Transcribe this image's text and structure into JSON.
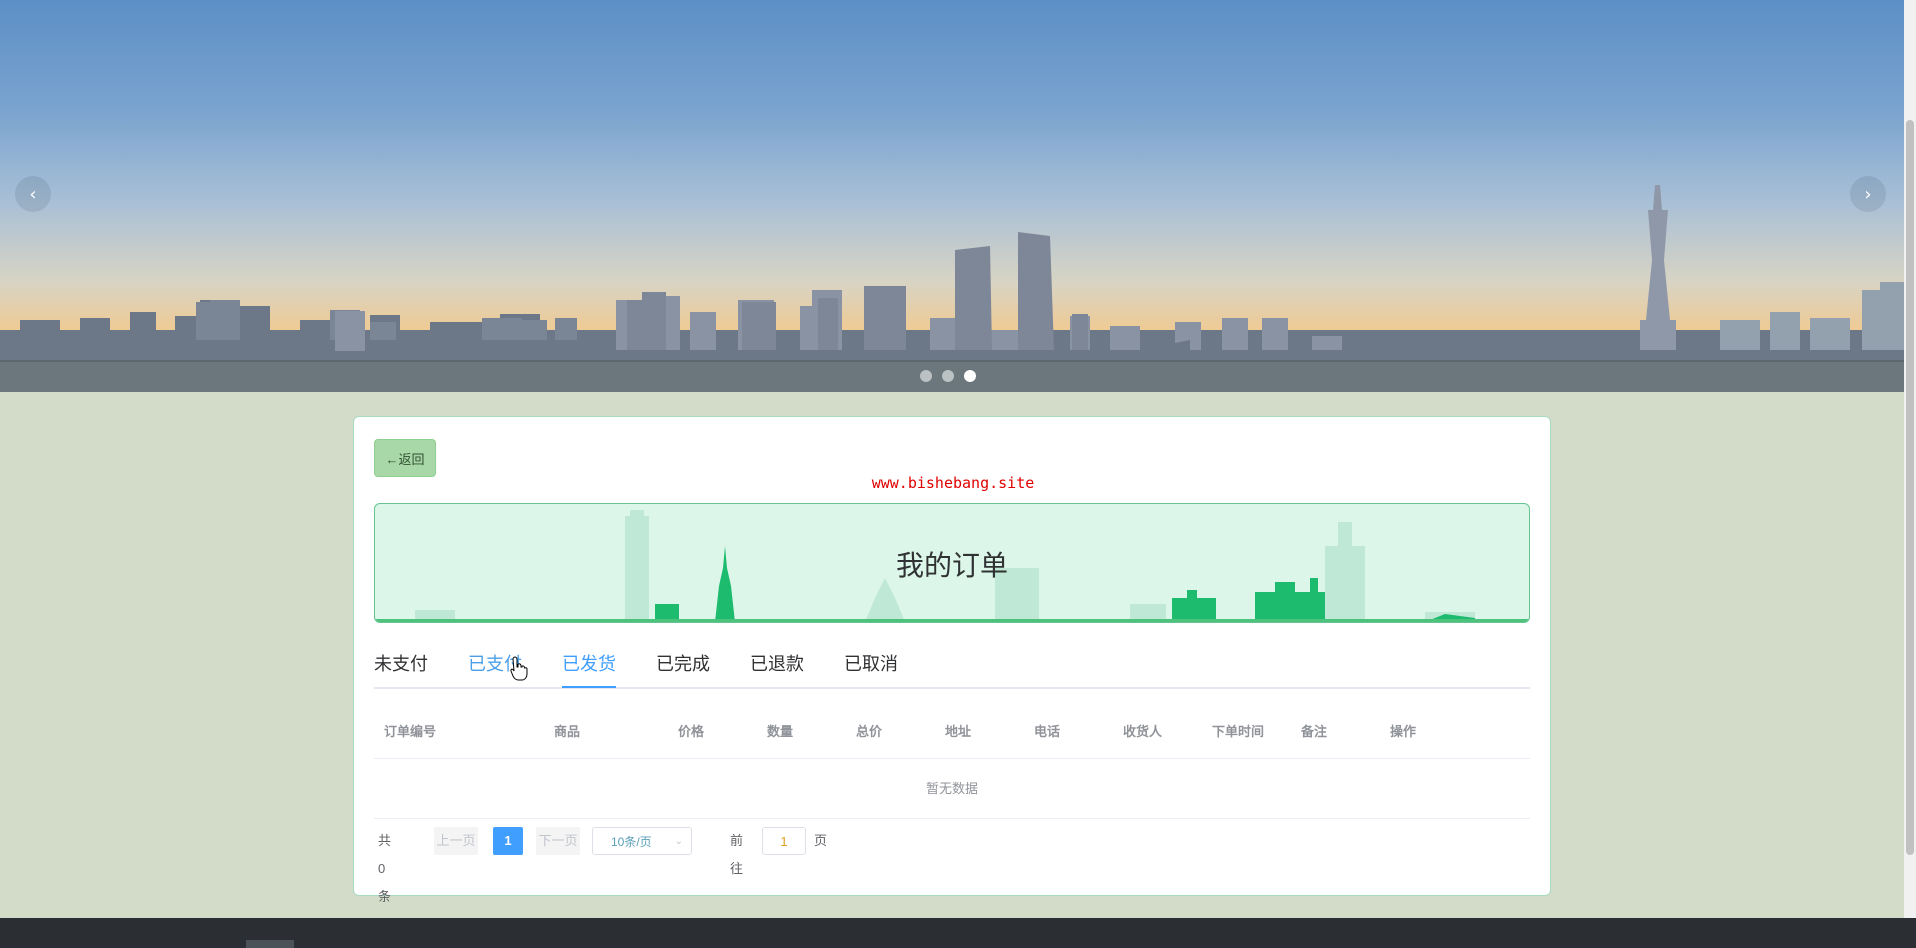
{
  "carousel": {
    "prev_icon": "‹",
    "next_icon": "›",
    "dots": [
      {
        "active": false
      },
      {
        "active": false
      },
      {
        "active": true
      }
    ]
  },
  "card": {
    "back_label": "←返回",
    "watermark": "www.bishebang.site",
    "page_title": "我的订单"
  },
  "tabs": [
    {
      "label": "未支付",
      "state": "normal"
    },
    {
      "label": "已支付",
      "state": "hover"
    },
    {
      "label": "已发货",
      "state": "active"
    },
    {
      "label": "已完成",
      "state": "normal"
    },
    {
      "label": "已退款",
      "state": "normal"
    },
    {
      "label": "已取消",
      "state": "normal"
    }
  ],
  "table": {
    "columns": [
      "订单编号",
      "商品",
      "价格",
      "数量",
      "总价",
      "地址",
      "电话",
      "收货人",
      "下单时间",
      "备注",
      "操作"
    ],
    "empty_text": "暂无数据"
  },
  "pagination": {
    "total": "共 0 条",
    "prev": "上一页",
    "current_page": "1",
    "next": "下一页",
    "page_size": "10条/页",
    "goto_prefix": "前往",
    "goto_value": "1",
    "goto_suffix": "页"
  },
  "colors": {
    "accent": "#409eff",
    "back_button": "#a8d8a8",
    "banner_fill": "#dcf6e9",
    "watermark": "#e00000"
  }
}
